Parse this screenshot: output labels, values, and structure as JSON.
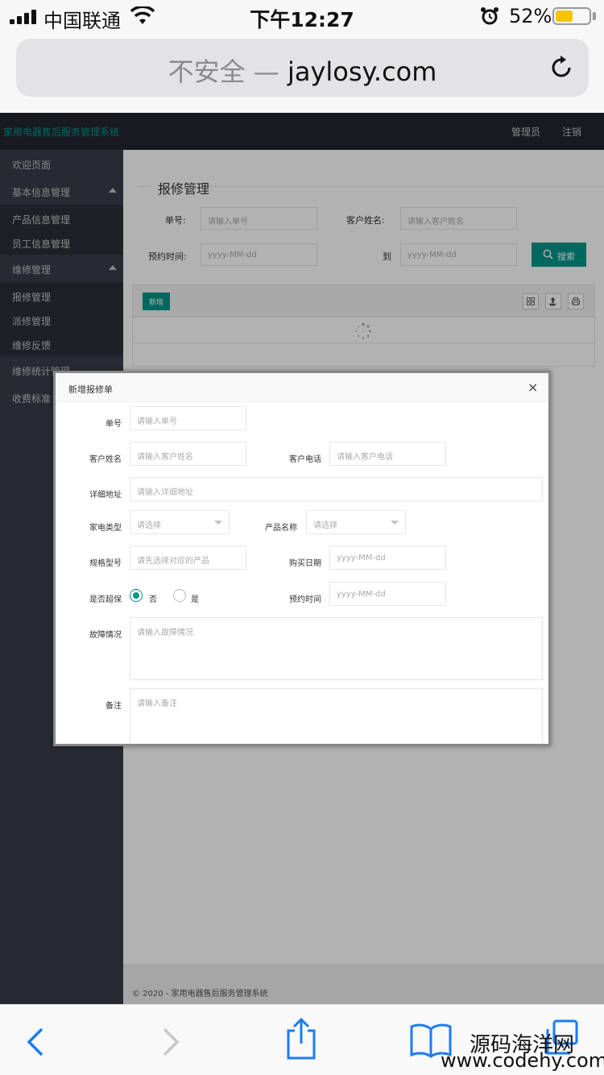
{
  "status_bar": {
    "carrier": "中国联通",
    "time": "下午12:27",
    "battery_percent": "52%",
    "battery_level": 0.52,
    "battery_color": "#f5c400"
  },
  "address_bar": {
    "security_label": "不安全 —",
    "domain": "jaylosy.com"
  },
  "app": {
    "brand": "家用电器售后服务管理系统",
    "brand_color": "#009688",
    "user_menu": "管理员",
    "logout": "注销"
  },
  "sidebar": {
    "items": [
      {
        "label": "欢迎页面",
        "kind": "group"
      },
      {
        "label": "基本信息管理",
        "kind": "group",
        "expanded": true
      },
      {
        "label": "产品信息管理",
        "kind": "sub"
      },
      {
        "label": "员工信息管理",
        "kind": "sub"
      },
      {
        "label": "维修管理",
        "kind": "group",
        "expanded": true
      },
      {
        "label": "报修管理",
        "kind": "sub"
      },
      {
        "label": "派修管理",
        "kind": "sub"
      },
      {
        "label": "维修反馈",
        "kind": "sub"
      },
      {
        "label": "维修统计管理",
        "kind": "group"
      },
      {
        "label": "收费标准",
        "kind": "group"
      }
    ]
  },
  "search_panel": {
    "title": "报修管理",
    "order_no_label": "单号:",
    "order_no_placeholder": "请输入单号",
    "customer_label": "客户姓名:",
    "customer_placeholder": "请输入客户姓名",
    "appointment_label": "预约时间:",
    "date_from_placeholder": "yyyy-MM-dd",
    "to_label": "到",
    "date_to_placeholder": "yyyy-MM-dd",
    "search_button": "搜索"
  },
  "table": {
    "add_button": "新增",
    "tool_icons": [
      "columns-icon",
      "export-icon",
      "print-icon"
    ]
  },
  "footer": {
    "text": "© 2020 - 家用电器售后服务管理系统"
  },
  "modal": {
    "title": "新增报修单",
    "close": "×",
    "fields": {
      "order_no": {
        "label": "单号",
        "placeholder": "请输入单号"
      },
      "customer_name": {
        "label": "客户姓名",
        "placeholder": "请输入客户姓名"
      },
      "customer_phone": {
        "label": "客户电话",
        "placeholder": "请输入客户电话"
      },
      "address": {
        "label": "详细地址",
        "placeholder": "请输入详细地址"
      },
      "appliance_type": {
        "label": "家电类型",
        "placeholder": "请选择"
      },
      "product_name": {
        "label": "产品名称",
        "placeholder": "请选择"
      },
      "model": {
        "label": "规格型号",
        "placeholder": "请先选择对应的产品"
      },
      "purchase_date": {
        "label": "购买日期",
        "placeholder": "yyyy-MM-dd"
      },
      "warranty": {
        "label": "是否超保",
        "options": [
          "否",
          "是"
        ],
        "selected": "否"
      },
      "appointment": {
        "label": "预约时间",
        "placeholder": "yyyy-MM-dd"
      },
      "fault": {
        "label": "故障情况",
        "placeholder": "请输入故障情况"
      },
      "remark": {
        "label": "备注",
        "placeholder": "请输入备注"
      }
    }
  },
  "watermark": {
    "site_cn": "源码海洋网",
    "site_url": "www.codehy.com"
  }
}
